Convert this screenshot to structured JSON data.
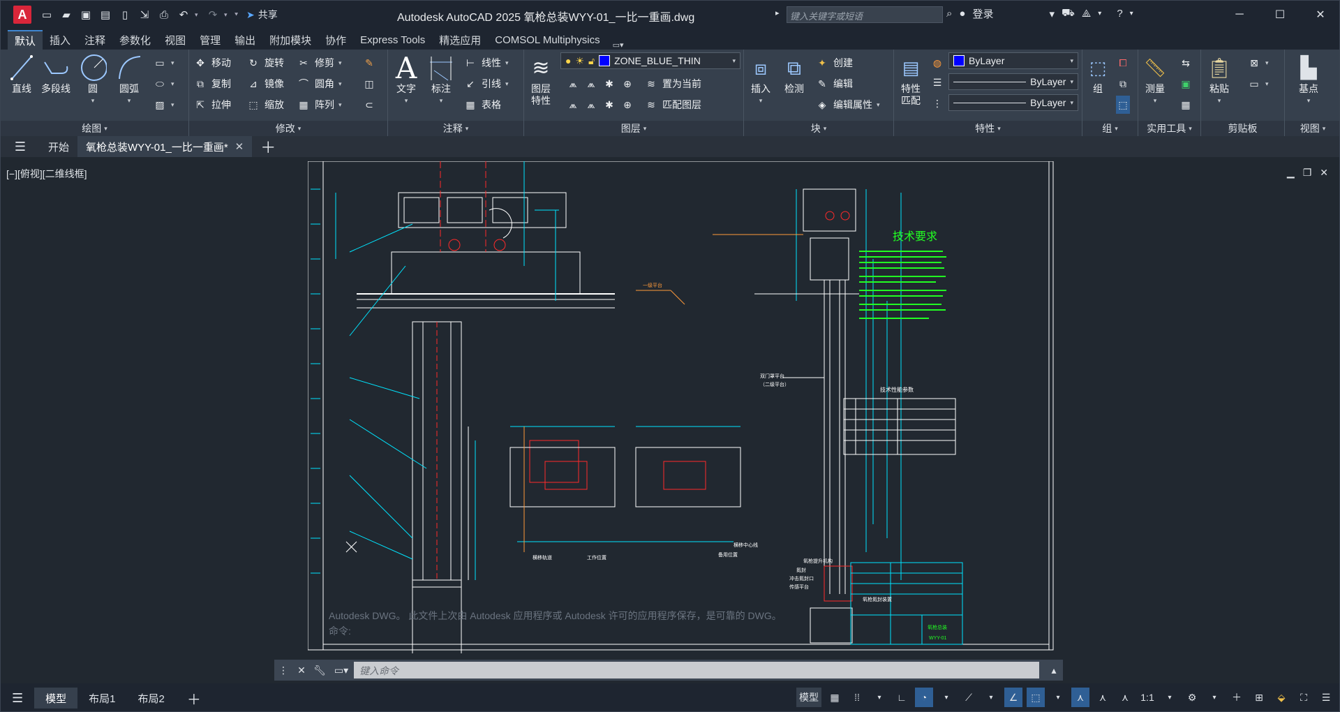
{
  "app": {
    "logo": "A",
    "title": "Autodesk AutoCAD 2025    氧枪总装WYY-01_一比一重画.dwg",
    "share_label": "共享",
    "search_placeholder": "键入关键字或短语",
    "login_label": "登录"
  },
  "ribbon_tabs": [
    "默认",
    "插入",
    "注释",
    "参数化",
    "视图",
    "管理",
    "输出",
    "附加模块",
    "协作",
    "Express Tools",
    "精选应用",
    "COMSOL Multiphysics"
  ],
  "panels": {
    "draw": {
      "title": "绘图",
      "line": "直线",
      "polyline": "多段线",
      "circle": "圆",
      "arc": "圆弧"
    },
    "modify": {
      "title": "修改",
      "move": "移动",
      "rotate": "旋转",
      "trim": "修剪",
      "copy": "复制",
      "mirror": "镜像",
      "fillet": "圆角",
      "stretch": "拉伸",
      "scale": "缩放",
      "array": "阵列"
    },
    "annotation": {
      "title": "注释",
      "text": "文字",
      "dimension": "标注",
      "linear": "线性",
      "leader": "引线",
      "table": "表格"
    },
    "layers": {
      "title": "图层",
      "layer_props": "图层\n特性",
      "current_layer": "ZONE_BLUE_THIN",
      "set_current": "置为当前",
      "match_layer": "匹配图层"
    },
    "block": {
      "title": "块",
      "insert": "插入",
      "inspect": "检测",
      "create": "创建",
      "edit": "编辑",
      "edit_attr": "编辑属性"
    },
    "properties": {
      "title": "特性",
      "match": "特性\n匹配",
      "color": "ByLayer",
      "linetype": "ByLayer",
      "lineweight": "ByLayer"
    },
    "groups": {
      "title": "组",
      "group": "组"
    },
    "utilities": {
      "title": "实用工具",
      "measure": "测量"
    },
    "clipboard": {
      "title": "剪贴板",
      "paste": "粘贴"
    },
    "view": {
      "title": "视图",
      "base": "基点"
    }
  },
  "doc_tabs": {
    "start": "开始",
    "active": "氧枪总装WYY-01_一比一重画*"
  },
  "viewport": {
    "label": "[−][俯视][二维线框]"
  },
  "drawing_text": {
    "tech_title": "技术要求",
    "table_title": "技术性能参数",
    "left_tag_1": "一级平台",
    "left_tag_2": "双门罩平台",
    "left_tag_3": "（二级平台）",
    "bottom_label_1": "横移轨道",
    "bottom_label_2": "工作位置",
    "bottom_label_3": "备用位置",
    "bottom_label_4": "横移中心线",
    "right_label_1": "氧枪提升机构",
    "bottom_right_1": "氧枪氮封装置",
    "bottom_right_2": "氮封",
    "bottom_right_3": "冲击氮封口",
    "bottom_right_4": "传感平台",
    "title_block_name": "氧枪总装",
    "title_block_no": "WYY-01"
  },
  "command": {
    "history_1": "Autodesk DWG。  此文件上次由 Autodesk 应用程序或 Autodesk 许可的应用程序保存，是可靠的 DWG。",
    "history_2": "命令:",
    "placeholder": "键入命令"
  },
  "status": {
    "model_tab": "模型",
    "layout1": "布局1",
    "layout2": "布局2",
    "space": "模型",
    "scale": "1:1"
  },
  "colors": {
    "accent": "#3f86d1",
    "drawing_cyan": "#00e5ff",
    "drawing_green": "#22ff22",
    "drawing_red": "#ff2a2a"
  }
}
